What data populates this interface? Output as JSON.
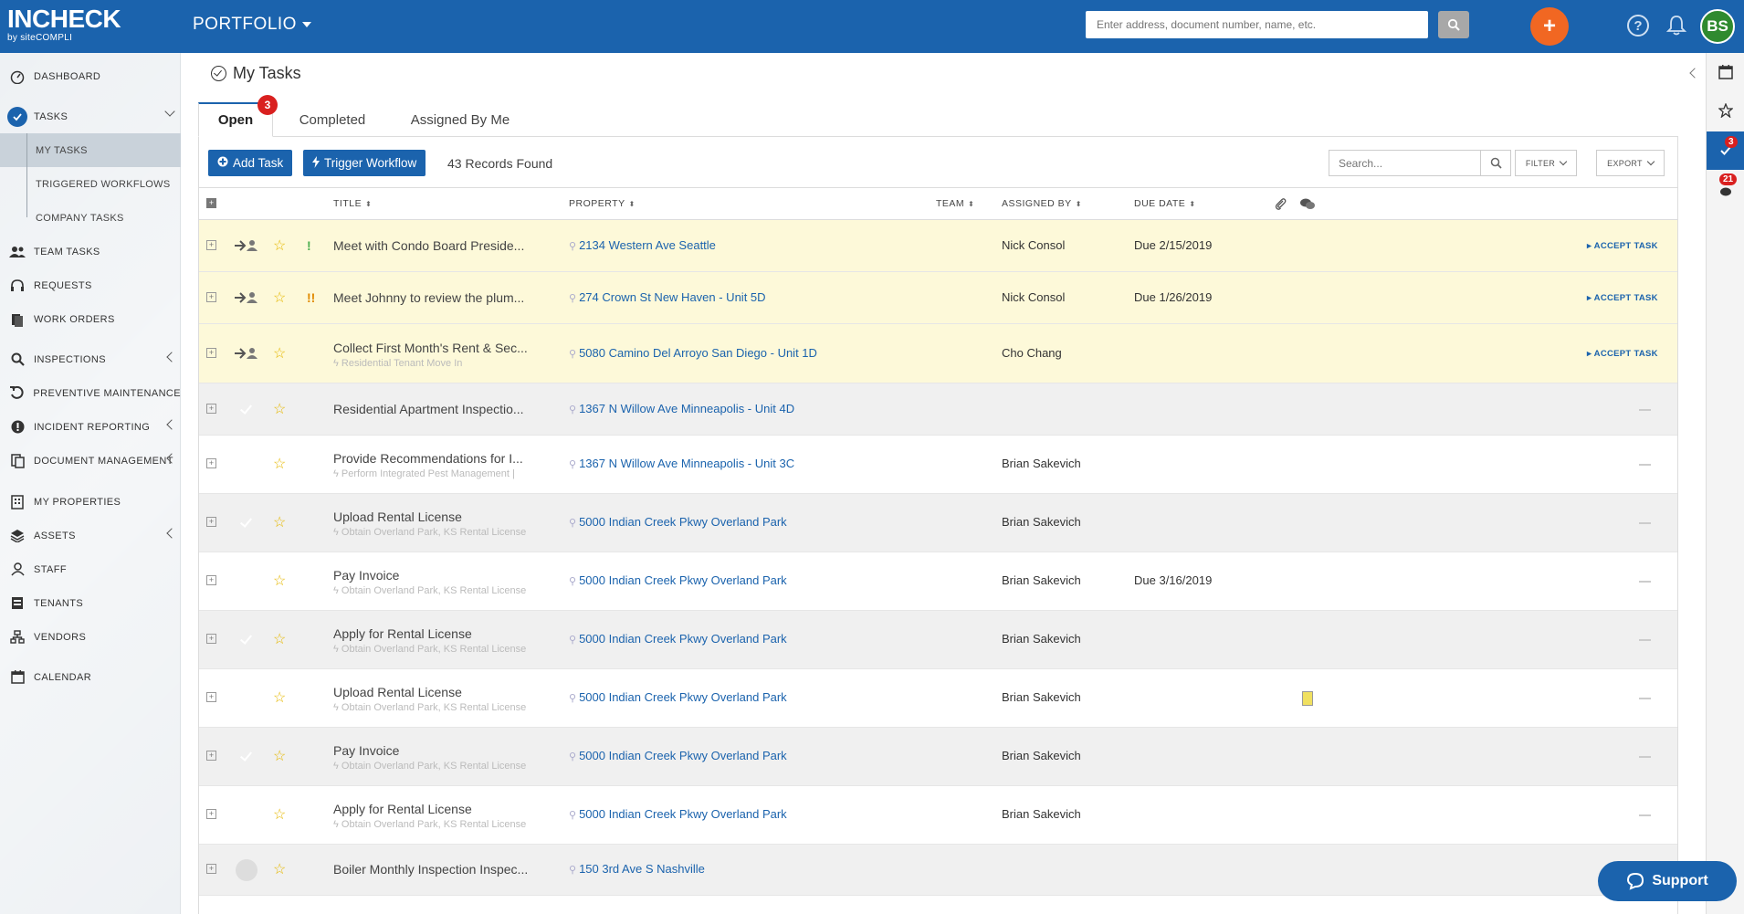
{
  "header": {
    "logo_main": "INCHECK",
    "logo_sub": "by siteCOMPLI",
    "portfolio_label": "PORTFOLIO",
    "search_placeholder": "Enter address, document number, name, etc.",
    "avatar_initials": "BS",
    "brand_color": "#1b63ad",
    "accent_color": "#f16722"
  },
  "sidebar": {
    "items": [
      {
        "label": "DASHBOARD",
        "icon": "gauge-icon"
      },
      {
        "label": "TASKS",
        "icon": "check-circle-icon"
      },
      {
        "label": "MY TASKS"
      },
      {
        "label": "TRIGGERED WORKFLOWS"
      },
      {
        "label": "COMPANY TASKS"
      },
      {
        "label": "TEAM TASKS",
        "icon": "users-icon"
      },
      {
        "label": "REQUESTS",
        "icon": "headset-icon"
      },
      {
        "label": "WORK ORDERS",
        "icon": "clipboard-icon"
      },
      {
        "label": "INSPECTIONS",
        "icon": "search-icon"
      },
      {
        "label": "PREVENTIVE MAINTENANCE",
        "icon": "refresh-icon"
      },
      {
        "label": "INCIDENT REPORTING",
        "icon": "alert-icon"
      },
      {
        "label": "DOCUMENT MANAGEMENT",
        "icon": "documents-icon"
      },
      {
        "label": "MY PROPERTIES",
        "icon": "building-icon"
      },
      {
        "label": "ASSETS",
        "icon": "layers-icon"
      },
      {
        "label": "STAFF",
        "icon": "person-icon"
      },
      {
        "label": "TENANTS",
        "icon": "id-card-icon"
      },
      {
        "label": "VENDORS",
        "icon": "org-icon"
      },
      {
        "label": "CALENDAR",
        "icon": "calendar-icon"
      }
    ]
  },
  "page": {
    "title": "My Tasks",
    "tabs": [
      {
        "label": "Open",
        "badge": "3"
      },
      {
        "label": "Completed"
      },
      {
        "label": "Assigned By Me"
      }
    ]
  },
  "toolbar": {
    "add_task": "Add Task",
    "trigger_workflow": "Trigger Workflow",
    "records": "43 Records Found",
    "search_placeholder": "Search...",
    "filter": "FILTER",
    "export": "EXPORT"
  },
  "table": {
    "columns": [
      "TITLE",
      "PROPERTY",
      "TEAM",
      "ASSIGNED BY",
      "DUE DATE"
    ],
    "rows": [
      {
        "title": "Meet with Condo Board Preside...",
        "sub": "",
        "property": "2134 Western Ave Seattle",
        "assigned_by": "Nick Consol",
        "due": "Due 2/15/2019",
        "action": "ACCEPT TASK",
        "priority": "!"
      },
      {
        "title": "Meet Johnny to review the plum...",
        "sub": "",
        "property": "274 Crown St New Haven - Unit 5D",
        "assigned_by": "Nick Consol",
        "due": "Due 1/26/2019",
        "action": "ACCEPT TASK",
        "priority": "!!"
      },
      {
        "title": "Collect First Month's Rent & Sec...",
        "sub": "Residential Tenant Move In",
        "property": "5080 Camino Del Arroyo San Diego - Unit 1D",
        "assigned_by": "Cho Chang",
        "due": "",
        "action": "ACCEPT TASK",
        "priority": ""
      },
      {
        "title": "Residential Apartment Inspectio...",
        "sub": "",
        "property": "1367 N Willow Ave Minneapolis - Unit 4D",
        "assigned_by": "",
        "due": "",
        "action": "",
        "priority": ""
      },
      {
        "title": "Provide Recommendations for I...",
        "sub": "Perform Integrated Pest Management |",
        "property": "1367 N Willow Ave Minneapolis - Unit 3C",
        "assigned_by": "Brian Sakevich",
        "due": "",
        "action": "",
        "priority": ""
      },
      {
        "title": "Upload Rental License",
        "sub": "Obtain Overland Park, KS Rental License",
        "property": "5000 Indian Creek Pkwy Overland Park",
        "assigned_by": "Brian Sakevich",
        "due": "",
        "action": "",
        "priority": ""
      },
      {
        "title": "Pay Invoice",
        "sub": "Obtain Overland Park, KS Rental License",
        "property": "5000 Indian Creek Pkwy Overland Park",
        "assigned_by": "Brian Sakevich",
        "due": "Due 3/16/2019",
        "action": "",
        "priority": ""
      },
      {
        "title": "Apply for Rental License",
        "sub": "Obtain Overland Park, KS Rental License",
        "property": "5000 Indian Creek Pkwy Overland Park",
        "assigned_by": "Brian Sakevich",
        "due": "",
        "action": "",
        "priority": ""
      },
      {
        "title": "Upload Rental License",
        "sub": "Obtain Overland Park, KS Rental License",
        "property": "5000 Indian Creek Pkwy Overland Park",
        "assigned_by": "Brian Sakevich",
        "due": "",
        "action": "",
        "priority": ""
      },
      {
        "title": "Pay Invoice",
        "sub": "Obtain Overland Park, KS Rental License",
        "property": "5000 Indian Creek Pkwy Overland Park",
        "assigned_by": "Brian Sakevich",
        "due": "",
        "action": "",
        "priority": ""
      },
      {
        "title": "Apply for Rental License",
        "sub": "Obtain Overland Park, KS Rental License",
        "property": "5000 Indian Creek Pkwy Overland Park",
        "assigned_by": "Brian Sakevich",
        "due": "",
        "action": "",
        "priority": ""
      },
      {
        "title": "Boiler Monthly Inspection Inspec...",
        "sub": "",
        "property": "150 3rd Ave S Nashville",
        "assigned_by": "",
        "due": "",
        "action": "",
        "priority": ""
      }
    ]
  },
  "rail": {
    "tasks_badge": "3",
    "other_badge": "21"
  },
  "support_label": "Support"
}
